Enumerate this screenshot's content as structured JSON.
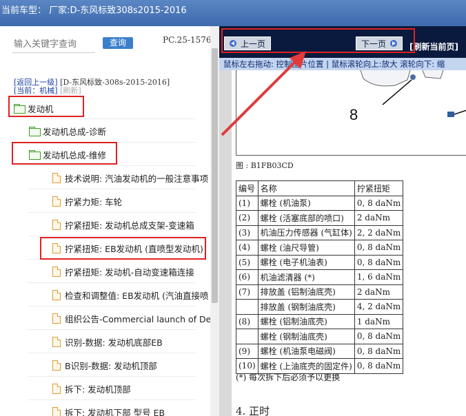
{
  "window": {
    "title": "当前车型：  厂家:D-东风标致308s2015-2016"
  },
  "search": {
    "placeholder": "输入关键字查询",
    "button_label": "查询",
    "pc_code": "PC.25-1576"
  },
  "breadcrumb": {
    "back_label": "[返回上一级]",
    "path": "[D-东风标致-308s-2015-2016]",
    "current_label": "[当前：机械]",
    "refresh_label": "[刷新]"
  },
  "tree": {
    "items": [
      {
        "label": "发动机",
        "type": "folder",
        "highlighted": true
      },
      {
        "label": "发动机总成-诊断",
        "type": "folder",
        "highlighted": false
      },
      {
        "label": "发动机总成-维修",
        "type": "folder",
        "highlighted": true
      },
      {
        "label": "技术说明: 汽油发动机的一般注意事项",
        "type": "doc",
        "highlighted": false
      },
      {
        "label": "拧紧力矩: 车轮",
        "type": "doc",
        "highlighted": false
      },
      {
        "label": "拧紧扭矩: 发动机总成支架-变速箱",
        "type": "doc",
        "highlighted": false
      },
      {
        "label": "拧紧扭矩: EB发动机 (直喷型发动机)",
        "type": "doc",
        "highlighted": true
      },
      {
        "label": "拧紧扭矩: 发动机-自动变速箱连接",
        "type": "doc",
        "highlighted": false
      },
      {
        "label": "检查和调整值: EB发动机 (汽油直接喷",
        "type": "doc",
        "highlighted": false
      },
      {
        "label": "组织公告-Commercial launch of DeNO",
        "type": "doc",
        "highlighted": false
      },
      {
        "label": "识别-数据: 发动机底部EB",
        "type": "doc",
        "highlighted": false
      },
      {
        "label": "B识别-数据: 发动机顶部",
        "type": "doc",
        "highlighted": false
      },
      {
        "label": "拆下: 发动机顶部",
        "type": "doc",
        "highlighted": false
      },
      {
        "label": "拆下: 发动机下部 型号 EB",
        "type": "doc",
        "highlighted": false
      }
    ]
  },
  "viewer": {
    "prev_label": "上一页",
    "next_label": "下一页",
    "refresh_label": "[刷新当前页]",
    "hint": "鼠标左右拖动: 控制图片位置 | 鼠标滚轮向上:放大  滚轮向下: 缩"
  },
  "document": {
    "figure_number": "8",
    "figure_caption": "图 :  B1FB03CD",
    "table": {
      "headers": [
        "编号",
        "名称",
        "拧紧扭矩"
      ],
      "rows": [
        [
          "(1)",
          "螺栓 (机油泵)",
          "0, 8  daNm"
        ],
        [
          "(2)",
          "螺栓 (活塞底部的喷口)",
          "2  daNm"
        ],
        [
          "(3)",
          "机油压力传感器 (气缸体)",
          "2, 2  daNm"
        ],
        [
          "(4)",
          "螺栓 (油尺导管)",
          "0, 8  daNm"
        ],
        [
          "(5)",
          "螺栓 (电子机油表)",
          "0, 8  daNm"
        ],
        [
          "(6)",
          "机油滤清器 (*)",
          "1, 6  daNm"
        ],
        [
          "(7)",
          "排放盖 (铝制油底壳)",
          "2  daNm"
        ],
        [
          "",
          "排放盖 (钢制油底壳)",
          "4, 2  daNm"
        ],
        [
          "(8)",
          "螺栓 (铝制油底壳)",
          "1  daNm"
        ],
        [
          "",
          "螺栓 (钢制油底壳)",
          "0, 8  daNm"
        ],
        [
          "(9)",
          "螺栓 (机油泵电磁阀)",
          "0, 8  daNm"
        ],
        [
          "(10)",
          "螺栓 (上油底壳的固定件)",
          "0, 8  daNm"
        ]
      ]
    },
    "note": "(*) 每次拆下后必须予以更换",
    "section_title": "4.   正时"
  },
  "colors": {
    "highlight": "#e02020",
    "nav_bar": "#0a1a3e",
    "hint_bar": "#c3d5ef",
    "title_bar": "#4a78bb",
    "query_button": "#3b7fcb"
  }
}
